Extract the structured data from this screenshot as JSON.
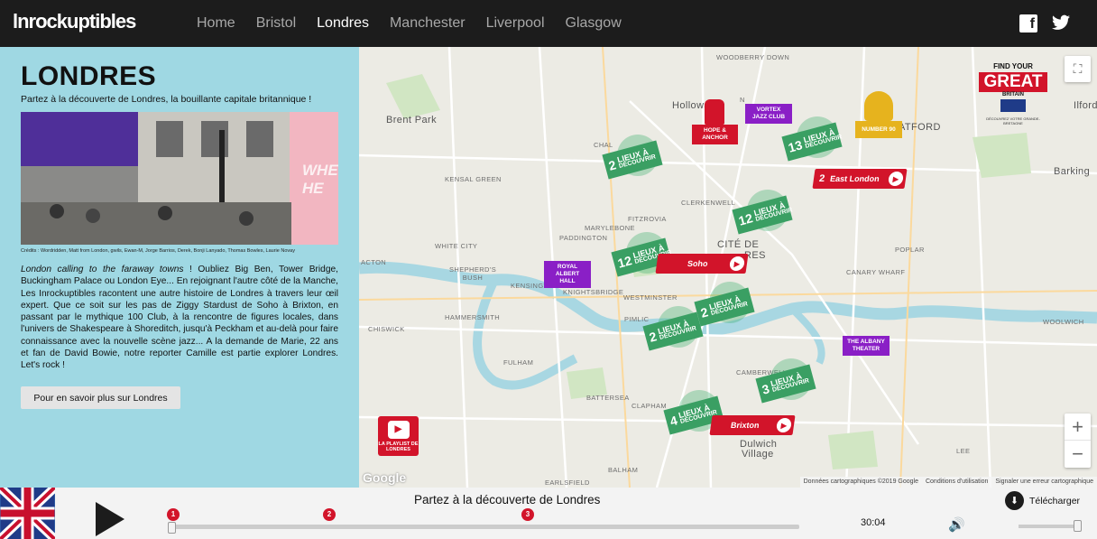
{
  "header": {
    "logo": "lnrockuptibles",
    "nav": [
      "Home",
      "Bristol",
      "Londres",
      "Manchester",
      "Liverpool",
      "Glasgow"
    ],
    "active_nav": "Londres",
    "facebook_icon": "f",
    "twitter_icon": "🐦"
  },
  "left": {
    "title": "LONDRES",
    "subtitle": "Partez à la découverte de Londres, la bouillante capitale britannique !",
    "photo_text": "WHE HE",
    "credits": "Crédits : Wordridden, Matt from London, gwils, Ewan-M, Jorge Barrios, Derek, Bonji Lanyado, Thomas Bowles, Laurie Novay",
    "desc_italic": "London calling to the faraway towns",
    "desc_rest": " ! Oubliez Big Ben, Tower Bridge, Buckingham Palace ou London Eye... En rejoignant l'autre côté de la Manche, Les Inrockuptibles racontent une autre histoire de Londres à travers leur œil expert. Que ce soit sur les pas de Ziggy Stardust de Soho à Brixton, en passant par le mythique 100 Club, à la rencontre de figures locales, dans l'univers de Shakespeare à Shoreditch, jusqu'à Peckham et au-delà pour faire connaissance avec la nouvelle scène jazz... A la demande de Marie, 22 ans et fan de David Bowie, notre reporter Camille est partie explorer Londres. Let's rock !",
    "more_button": "Pour en savoir plus sur Londres"
  },
  "map": {
    "labels": {
      "woodberry": "WOODBERRY DOWN",
      "brent": "Brent Park",
      "holloway": "Hollowa",
      "n": "N",
      "stratford": "ATFORD",
      "ilford": "Ilford",
      "chal": "CHAL",
      "kensal": "KENSAL GREEN",
      "clerkenwell": "CLERKENWELL",
      "barking": "Barking",
      "paddington": "PADDINGTON",
      "marylebone": "MARYLEBONE",
      "fitzrovia": "FITZROVIA",
      "cite": "CITÉ DE",
      "cite2": "RES",
      "white_city": "WHITE CITY",
      "acton": "ACTON",
      "shepherds": "SHEPHERD'S BUSH",
      "kensington": "KENSINGTON",
      "knightsbridge": "KNIGHTSBRIDGE",
      "westminster": "WESTMINSTER",
      "poplar": "POPLAR",
      "canary": "CANARY WHARF",
      "hammersmith": "HAMMERSMITH",
      "chiswick": "CHISWICK",
      "pimlico": "PIMLIC",
      "woolwich": "WOOLWICH",
      "fulham": "FULHAM",
      "camberwell": "CAMBERWELL",
      "battersea": "BATTERSEA",
      "clapham": "CLAPHAM",
      "dulwich": "Dulwich",
      "village": "Village",
      "lee": "LEE",
      "balham": "BALHAM",
      "earlsfield": "EARLSFIELD"
    },
    "green_badges": [
      {
        "n": "2",
        "l1": "LIEUX À",
        "l2": "DÉCOUVRIR"
      },
      {
        "n": "13",
        "l1": "LIEUX À",
        "l2": "DÉCOUVRIR"
      },
      {
        "n": "12",
        "l1": "LIEUX À",
        "l2": "DÉCOUVRIR"
      },
      {
        "n": "12",
        "l1": "LIEUX À",
        "l2": "DÉCOUVRIR"
      },
      {
        "n": "2",
        "l1": "LIEUX À",
        "l2": "DÉCOUVRIR"
      },
      {
        "n": "2",
        "l1": "LIEUX À",
        "l2": "DÉCOUVRIR"
      },
      {
        "n": "3",
        "l1": "LIEUX À",
        "l2": "DÉCOUVRIR"
      },
      {
        "n": "4",
        "l1": "LIEUX À",
        "l2": "DÉCOUVRIR"
      }
    ],
    "red_badges": [
      {
        "n": "2",
        "label": "East London"
      },
      {
        "n": "",
        "label": "Soho"
      },
      {
        "n": "",
        "label": "Brixton"
      }
    ],
    "purple_badges": [
      {
        "label1": "VORTEX",
        "label2": "JAZZ CLUB"
      },
      {
        "label1": "ROYAL ALBERT",
        "label2": "HALL"
      },
      {
        "label1": "THE ALBANY",
        "label2": "THEATER"
      }
    ],
    "hope": "HOPE & ANCHOR",
    "number90": "NUMBER 90",
    "great": {
      "line1": "FIND YOUR",
      "line2": "GREAT",
      "line3": "BRITAIN",
      "line4": "DÉCOUVREZ VOTRE GRANDE-BRETAGNE"
    },
    "playlist": "LA PLAYLIST DE LONDRES",
    "google": "Google",
    "footer": [
      "Données cartographiques ©2019 Google",
      "Conditions d'utilisation",
      "Signaler une erreur cartographique"
    ],
    "colors": {
      "water": "#a8d7e2",
      "road": "#ffffff",
      "green": "#3a9f63",
      "red": "#d2142a",
      "purple": "#8a1fc6"
    }
  },
  "player": {
    "title": "Partez à la découverte de Londres",
    "markers": [
      "1",
      "2",
      "3"
    ],
    "time": "30:04",
    "download": "Télécharger",
    "progress": 0
  }
}
